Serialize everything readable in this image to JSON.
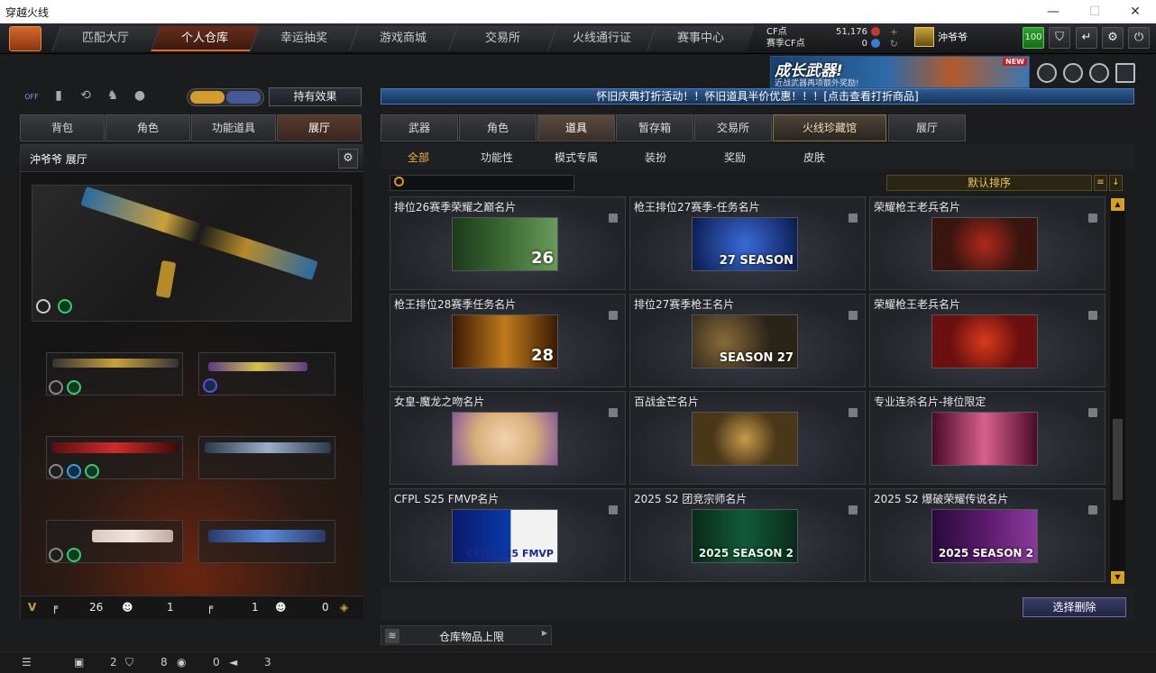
{
  "window": {
    "title": "穿越火线",
    "min": "—",
    "max": "☐",
    "close": "✕"
  },
  "nav": {
    "tabs": [
      "匹配大厅",
      "个人仓库",
      "幸运抽奖",
      "游戏商城",
      "交易所",
      "火线通行证",
      "赛事中心"
    ],
    "active": 1
  },
  "currency": {
    "cf_label": "CF点",
    "cf_value": "51,176",
    "season_label": "赛季CF点",
    "season_value": "0"
  },
  "user": {
    "name": "沖爷爷",
    "level": "100"
  },
  "banner": {
    "title": "成长武器!",
    "sub": "近战武器再项额外奖励!",
    "new": "NEW"
  },
  "left": {
    "toggle_off": "OFF",
    "effect_button": "持有效果",
    "tabs": [
      "背包",
      "角色",
      "功能道具",
      "展厅"
    ],
    "panel_title": "沖爷爷 展厅",
    "footer": {
      "rifle_count": "26",
      "mask_count": "1",
      "pistol_count": "1",
      "head_count": "0"
    }
  },
  "announcement": "怀旧庆典打折活动！！怀旧道具半价优惠！！！[点击查看打折商品]",
  "right": {
    "tabs": [
      "武器",
      "角色",
      "道具",
      "暂存箱",
      "交易所",
      "火线珍藏馆",
      "展厅"
    ],
    "subtabs": [
      "全部",
      "功能性",
      "模式专属",
      "装扮",
      "奖励",
      "皮肤"
    ],
    "sort": "默认排序"
  },
  "cards": [
    {
      "name": "排位26赛季荣耀之巅名片",
      "thumb": "26",
      "bg": "#3c6a34"
    },
    {
      "name": "枪王排位27赛季-任务名片",
      "thumb": "27 SEASON",
      "bg": "#1f3f8c"
    },
    {
      "name": "荣耀枪王老兵名片",
      "thumb": "",
      "bg": "#3a1510"
    },
    {
      "name": "枪王排位28赛季任务名片",
      "thumb": "28",
      "bg": "#7a3d0a"
    },
    {
      "name": "排位27赛季枪王名片",
      "thumb": "SEASON 27",
      "bg": "#2a2418"
    },
    {
      "name": "荣耀枪王老兵名片",
      "thumb": "",
      "bg": "#6a1010"
    },
    {
      "name": "女皇-魔龙之吻名片",
      "thumb": "",
      "bg": "#d8b07a"
    },
    {
      "name": "百战金芒名片",
      "thumb": "",
      "bg": "#4a3618"
    },
    {
      "name": "专业连杀名片-排位限定",
      "thumb": "",
      "bg": "#8a1a4a"
    },
    {
      "name": "CFPL S25 FMVP名片",
      "thumb": "CFPL S25 FMVP",
      "bg": "#0a3aa8"
    },
    {
      "name": "2025 S2 团竞宗师名片",
      "thumb": "2025 SEASON 2",
      "bg": "#125a3a"
    },
    {
      "name": "2025 S2 爆破荣耀传说名片",
      "thumb": "2025 SEASON 2",
      "bg": "#5a1a6a"
    }
  ],
  "delete_button": "选择删除",
  "capacity": "仓库物品上限",
  "status": {
    "a": "2",
    "b": "8",
    "c": "0",
    "d": "3"
  }
}
